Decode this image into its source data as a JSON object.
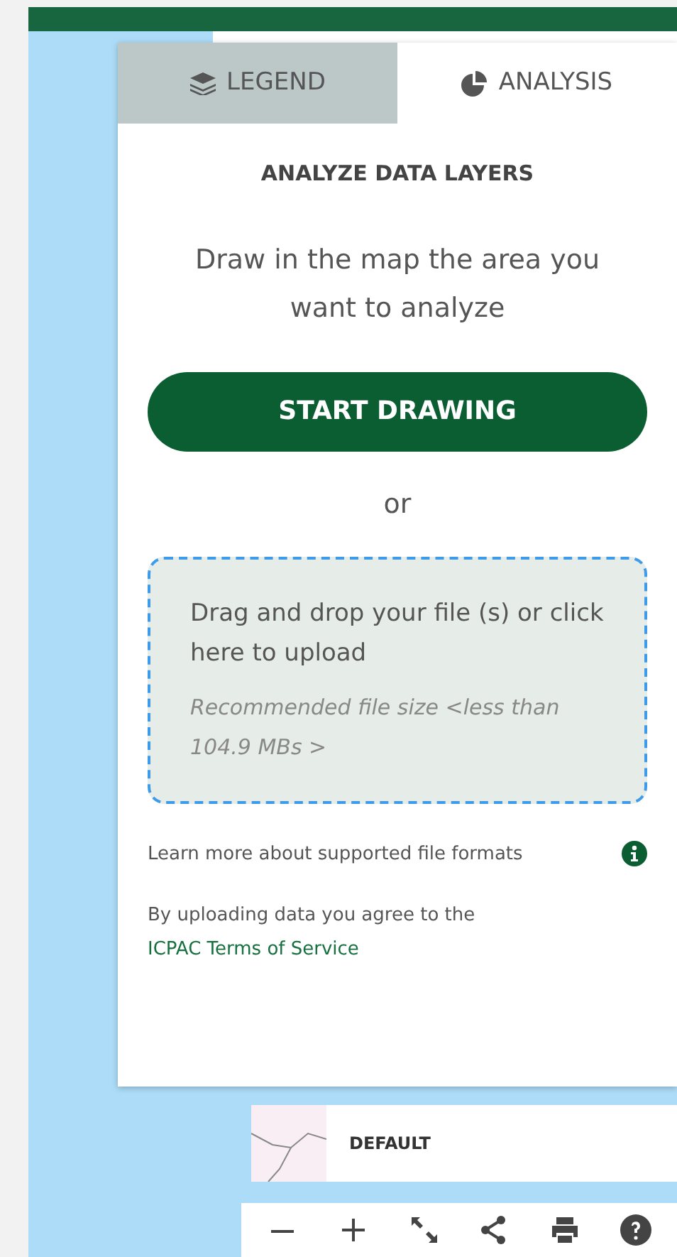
{
  "tabs": [
    {
      "label": "LEGEND",
      "selected": false
    },
    {
      "label": "ANALYSIS",
      "selected": true
    }
  ],
  "analysis": {
    "heading": "ANALYZE DATA LAYERS",
    "instruction": "Draw in the map the area you want to analyze",
    "draw_button": "START DRAWING",
    "separator": "or",
    "upload": {
      "text": "Drag and drop your file (s) or click here to upload",
      "note": "Recommended file size <less than 104.9 MBs >"
    },
    "formats_link": "Learn more about supported file formats",
    "terms": {
      "text": "By uploading data you agree to the",
      "link": "ICPAC Terms of Service"
    }
  },
  "basemap": {
    "label": "DEFAULT"
  }
}
